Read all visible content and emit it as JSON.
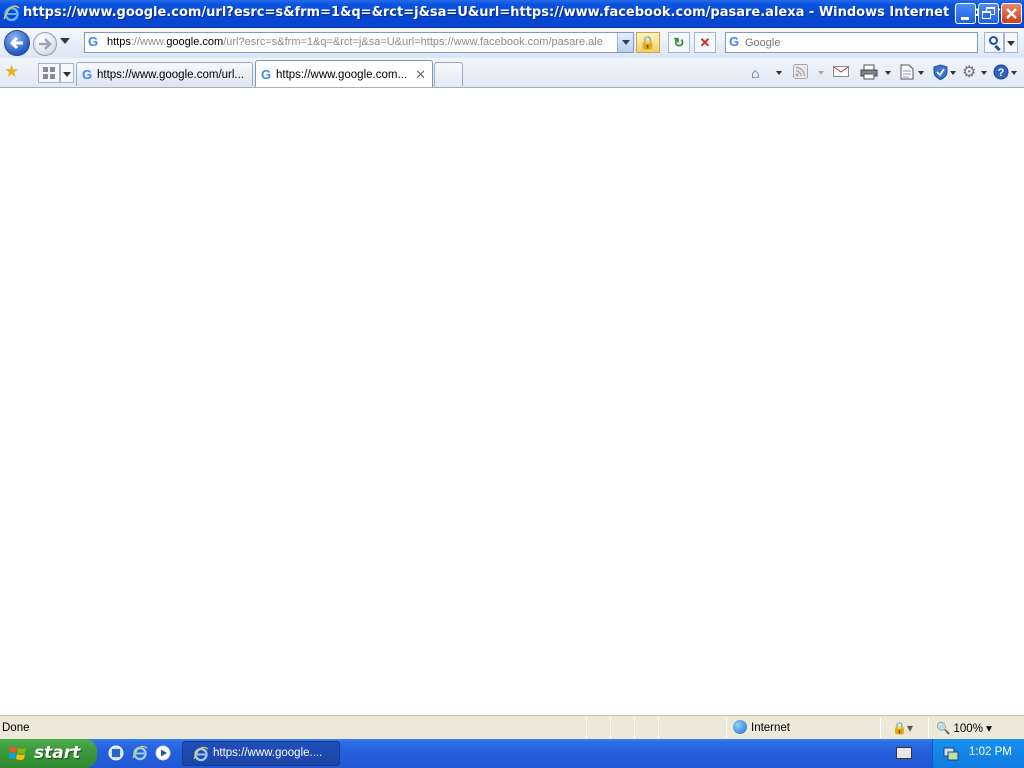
{
  "window": {
    "title": "https://www.google.com/url?esrc=s&frm=1&q=&rct=j&sa=U&url=https://www.facebook.com/pasare.alexa - Windows Internet Explorer"
  },
  "navbar": {
    "address_prefix": "https",
    "address_host_sep": "://www.",
    "address_host": "google.com",
    "address_rest": "/url?esrc=s&frm=1&q=&rct=j&sa=U&url=https://www.facebook.com/pasare.ale",
    "search_placeholder": "Google"
  },
  "tabs": [
    {
      "label": "https://www.google.com/url...",
      "active": false
    },
    {
      "label": "https://www.google.com...",
      "active": true
    }
  ],
  "status": {
    "text": "Done",
    "zone": "Internet",
    "zoom": "100%"
  },
  "taskbar": {
    "start_label": "start",
    "task_label": "https://www.google....",
    "clock": "1:02 PM"
  },
  "icons": {
    "favorites": "star-icon",
    "home": "home-icon",
    "feeds": "rss-icon",
    "mail": "mail-icon",
    "print": "printer-icon",
    "page": "page-icon",
    "safety": "shield-icon",
    "tools": "gear-icon",
    "help": "help-icon"
  }
}
